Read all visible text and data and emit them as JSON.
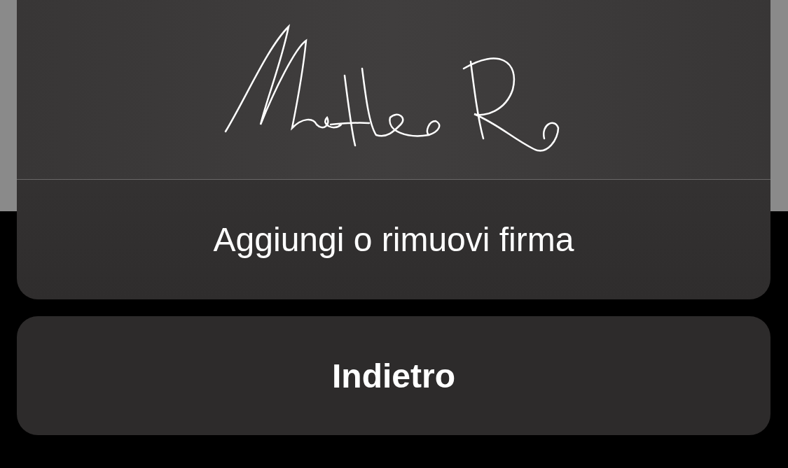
{
  "signatures": [
    {
      "kind": "handwritten"
    }
  ],
  "actions": [
    {
      "label": "Aggiungi o rimuovi firma"
    }
  ],
  "cancel": {
    "label": "Indietro"
  }
}
